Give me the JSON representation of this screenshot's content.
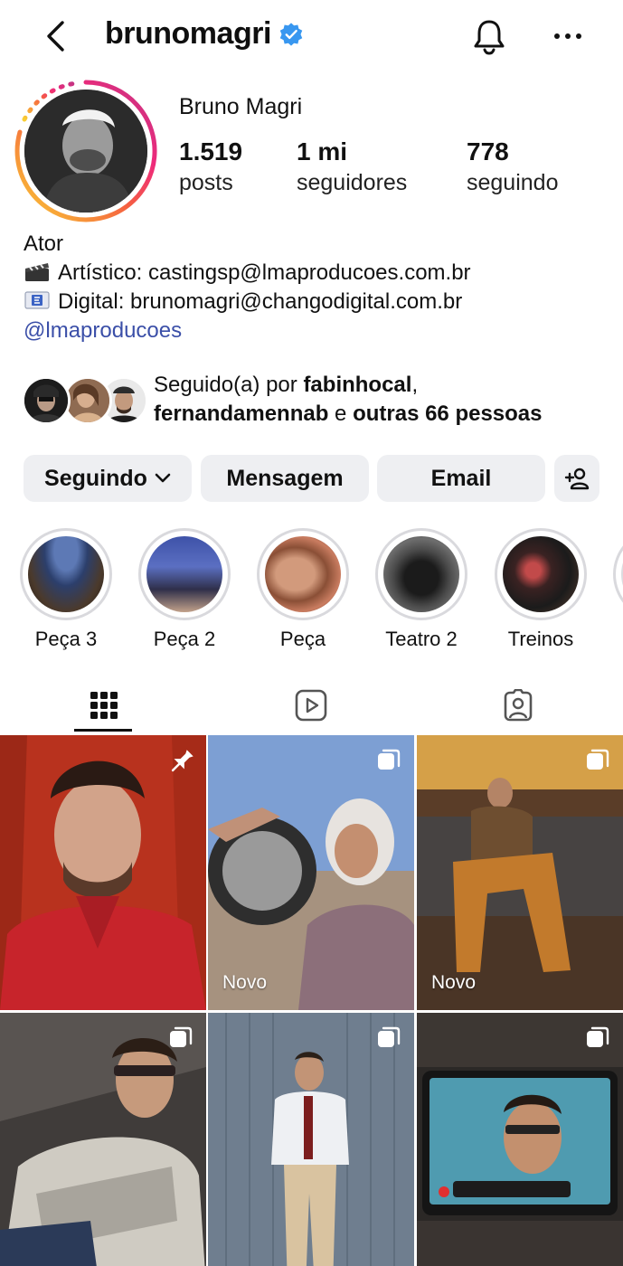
{
  "header": {
    "username": "brunomagri",
    "verified": true
  },
  "profile": {
    "full_name": "Bruno Magri",
    "stats": [
      {
        "value": "1.519",
        "label": "posts"
      },
      {
        "value": "1 mi",
        "label": "seguidores"
      },
      {
        "value": "778",
        "label": "seguindo"
      }
    ],
    "bio": {
      "category": "Ator",
      "line1": "Artístico: castingsp@lmaproducoes.com.br",
      "line2": "Digital: brunomagri@changodigital.com.br",
      "link": "@lmaproducoes"
    }
  },
  "followed_by": {
    "prefix": "Seguido(a) por ",
    "user1": "fabinhocal",
    "comma": ",",
    "user2": "fernandamennab",
    "connector": " e ",
    "others": "outras 66 pessoas"
  },
  "buttons": {
    "following": "Seguindo",
    "message": "Mensagem",
    "email": "Email"
  },
  "highlights": [
    {
      "label": "Peça 3"
    },
    {
      "label": "Peça 2"
    },
    {
      "label": "Peça"
    },
    {
      "label": "Teatro 2"
    },
    {
      "label": "Treinos"
    }
  ],
  "grid": {
    "posts": [
      {
        "badge": "",
        "icon": "pin-icon"
      },
      {
        "badge": "Novo",
        "icon": "carousel-icon"
      },
      {
        "badge": "Novo",
        "icon": "carousel-icon"
      },
      {
        "badge": "",
        "icon": "carousel-icon"
      },
      {
        "badge": "",
        "icon": "carousel-icon"
      },
      {
        "badge": "",
        "icon": "carousel-icon"
      }
    ]
  },
  "colors": {
    "verified_blue": "#3897f0",
    "link_blue": "#3b4fa8",
    "button_bg": "#eeeff2",
    "story_ring_start": "#f9ce34",
    "story_ring_mid": "#ee2a7b",
    "story_ring_end": "#6228d7"
  }
}
